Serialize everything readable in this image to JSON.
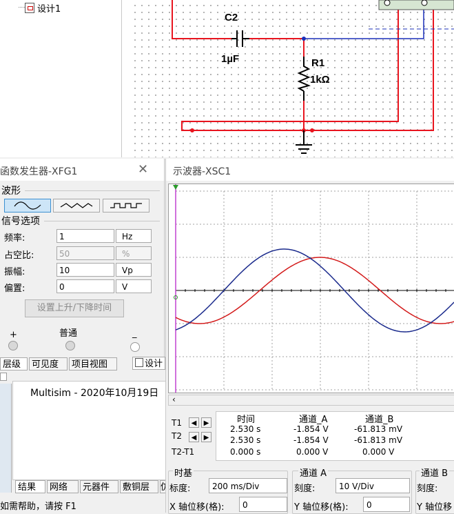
{
  "design_tree": {
    "item": "设计1"
  },
  "schematic": {
    "capacitor": {
      "ref": "C2",
      "value": "1µF"
    },
    "resistor": {
      "ref": "R1",
      "value": "1kΩ"
    },
    "colors": {
      "wire_red": "#e8141e",
      "wire_blue": "#1a2fb8",
      "component": "#000000"
    }
  },
  "function_generator": {
    "title": "函数发生器-XFG1",
    "close": "✕",
    "waveform_group": "波形",
    "waveforms": [
      "sine",
      "triangle",
      "square"
    ],
    "selected_waveform": "sine",
    "signal_group": "信号选项",
    "fields": [
      {
        "label": "频率:",
        "value": "1",
        "unit": "Hz",
        "disabled": false
      },
      {
        "label": "占空比:",
        "value": "50",
        "unit": "%",
        "disabled": true
      },
      {
        "label": "振幅:",
        "value": "10",
        "unit": "Vp",
        "disabled": false
      },
      {
        "label": "偏置:",
        "value": "0",
        "unit": "V",
        "disabled": false
      }
    ],
    "rise_fall_button": "设置上升/下降时间",
    "terminals": {
      "plus": "+",
      "common": "普通",
      "minus": "_"
    }
  },
  "bottom_tabs": [
    "层级",
    "可见度",
    "项目视图"
  ],
  "design_tab": "设计",
  "message": "Multisim  -  2020年10月19日",
  "output_tabs": [
    "结果",
    "网络",
    "元器件",
    "敷铜层",
    "仿"
  ],
  "status_text": "如需帮助，请按 F1",
  "oscilloscope": {
    "title": "示波器-XSC1",
    "colors": {
      "channel_a": "#d31a1a",
      "channel_b": "#1a2a8c",
      "grid": "#a0a0a0",
      "cursor": "#c040d0"
    },
    "readout": {
      "headers": [
        "时间",
        "通道_A",
        "通道_B"
      ],
      "rows": [
        {
          "label": "T1",
          "time": "2.530 s",
          "a": "-1.854 V",
          "b": "-61.813 mV"
        },
        {
          "label": "T2",
          "time": "2.530 s",
          "a": "-1.854 V",
          "b": "-61.813 mV"
        },
        {
          "label": "T2-T1",
          "time": "0.000 s",
          "a": "0.000 V",
          "b": "0.000 V"
        }
      ]
    },
    "timebase": {
      "title": "时基",
      "scale_label": "标度:",
      "scale": "200 ms/Div",
      "xpos_label": "X 轴位移(格):",
      "xpos": "0"
    },
    "channel_a": {
      "title": "通道 A",
      "scale_label": "刻度:",
      "scale": "10  V/Div",
      "ypos_label": "Y 轴位移(格):",
      "ypos": "0"
    },
    "channel_b": {
      "title": "通道 B",
      "scale_label": "刻度:",
      "ypos_label": "Y 轴位移"
    }
  }
}
